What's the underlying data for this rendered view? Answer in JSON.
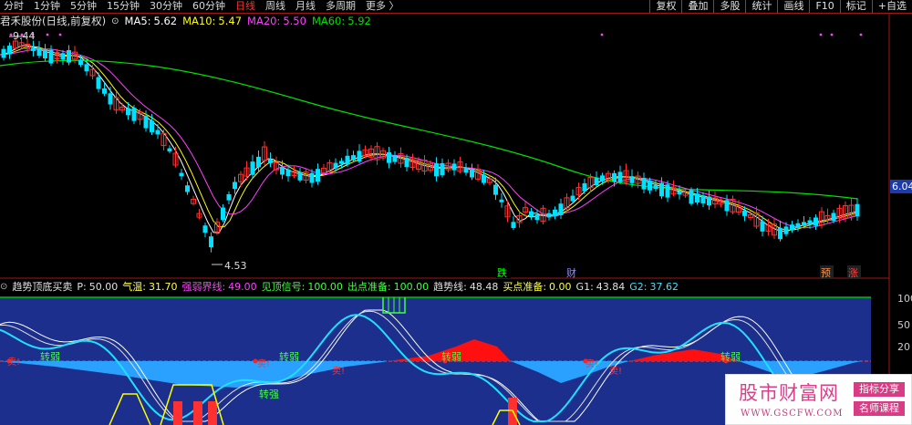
{
  "toolbar": {
    "periods": [
      "分时",
      "1分钟",
      "5分钟",
      "15分钟",
      "30分钟",
      "60分钟",
      "日线",
      "周线",
      "月线",
      "多周期",
      "更多 〉"
    ],
    "active_period": "日线",
    "buttons": [
      "复权",
      "叠加",
      "多股",
      "统计",
      "画线",
      "F10",
      "标记",
      "+自选"
    ]
  },
  "main_chart": {
    "stock_name": "君禾股份",
    "mode": "(日线,前复权)",
    "ma5_label": "MA5:",
    "ma5_value": "5.62",
    "ma10_label": "MA10:",
    "ma10_value": "5.47",
    "ma20_label": "MA20:",
    "ma20_value": "5.50",
    "ma60_label": "MA60:",
    "ma60_value": "5.92",
    "high_label": "9.44",
    "low_label": "4.53",
    "price_tag": "6.04",
    "signal_die": "跌",
    "signal_cai": "财",
    "signal_yu": "预",
    "signal_zhang": "涨"
  },
  "indicator": {
    "name": "趋势顶底买卖",
    "p_label": "P:",
    "p_value": "50.00",
    "qiwen_label": "气温:",
    "qiwen_value": "31.70",
    "qiangruo_label": "强弱界线:",
    "qiangruo_value": "49.00",
    "jianding_label": "见顶信号:",
    "jianding_value": "100.00",
    "chudian_label": "出点准备:",
    "chudian_value": "100.00",
    "qushi_label": "趋势线:",
    "qushi_value": "48.48",
    "maidian_label": "买点准备:",
    "maidian_value": "0.00",
    "g1_label": "G1:",
    "g1_value": "43.84",
    "g2_label": "G2:",
    "g2_value": "37.62",
    "axis_labels": [
      "100",
      "50",
      "20"
    ],
    "signal_zhuanqiang": "转强",
    "signal_zhuanruo": "转弱",
    "signal_maidian": "卖!",
    "signal_mai": "买!"
  },
  "watermark": {
    "title": "股市财富网",
    "url": "WWW.GSCFW.COM",
    "tag1": "指标分享",
    "tag2": "名师课程"
  },
  "colors": {
    "up": "#ff3030",
    "down": "#00e0ff",
    "ma5": "#ffffff",
    "ma10": "#ffff00",
    "ma20": "#ff40ff",
    "ma60": "#00e000",
    "indicator_bg": "#1c2f8c"
  }
}
